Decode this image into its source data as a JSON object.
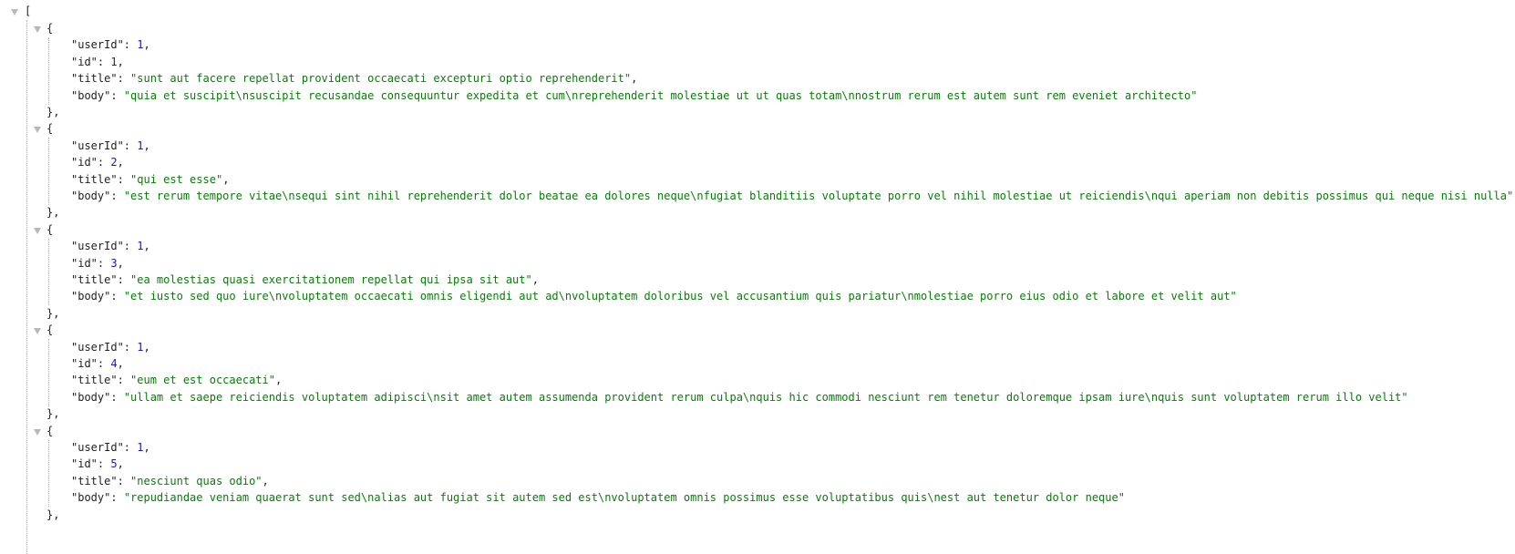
{
  "open_bracket": "[",
  "open_brace": "{",
  "close_brace": "},",
  "keys": {
    "userId": "\"userId\"",
    "id": "\"id\"",
    "title": "\"title\"",
    "body": "\"body\""
  },
  "colon": ": ",
  "comma": ",",
  "colors": {
    "number": "#1a1aa6",
    "string": "#0b7a0b",
    "punctuation": "#222222",
    "toggle": "#b8b8b8"
  },
  "posts": [
    {
      "userId": "1",
      "id": "1",
      "title": "\"sunt aut facere repellat provident occaecati excepturi optio reprehenderit\"",
      "body": "\"quia et suscipit\\nsuscipit recusandae consequuntur expedita et cum\\nreprehenderit molestiae ut ut quas totam\\nnostrum rerum est autem sunt rem eveniet architecto\""
    },
    {
      "userId": "1",
      "id": "2",
      "title": "\"qui est esse\"",
      "body": "\"est rerum tempore vitae\\nsequi sint nihil reprehenderit dolor beatae ea dolores neque\\nfugiat blanditiis voluptate porro vel nihil molestiae ut reiciendis\\nqui aperiam non debitis possimus qui neque nisi nulla\""
    },
    {
      "userId": "1",
      "id": "3",
      "title": "\"ea molestias quasi exercitationem repellat qui ipsa sit aut\"",
      "body": "\"et iusto sed quo iure\\nvoluptatem occaecati omnis eligendi aut ad\\nvoluptatem doloribus vel accusantium quis pariatur\\nmolestiae porro eius odio et labore et velit aut\""
    },
    {
      "userId": "1",
      "id": "4",
      "title": "\"eum et est occaecati\"",
      "body": "\"ullam et saepe reiciendis voluptatem adipisci\\nsit amet autem assumenda provident rerum culpa\\nquis hic commodi nesciunt rem tenetur doloremque ipsam iure\\nquis sunt voluptatem rerum illo velit\""
    },
    {
      "userId": "1",
      "id": "5",
      "title": "\"nesciunt quas odio\"",
      "body": "\"repudiandae veniam quaerat sunt sed\\nalias aut fugiat sit autem sed est\\nvoluptatem omnis possimus esse voluptatibus quis\\nest aut tenetur dolor neque\""
    }
  ]
}
